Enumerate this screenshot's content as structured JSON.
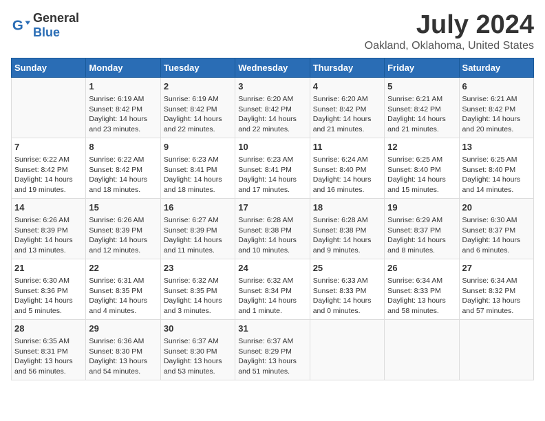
{
  "header": {
    "logo_general": "General",
    "logo_blue": "Blue",
    "title": "July 2024",
    "subtitle": "Oakland, Oklahoma, United States"
  },
  "weekdays": [
    "Sunday",
    "Monday",
    "Tuesday",
    "Wednesday",
    "Thursday",
    "Friday",
    "Saturday"
  ],
  "weeks": [
    [
      {
        "day": "",
        "content": ""
      },
      {
        "day": "1",
        "content": "Sunrise: 6:19 AM\nSunset: 8:42 PM\nDaylight: 14 hours\nand 23 minutes."
      },
      {
        "day": "2",
        "content": "Sunrise: 6:19 AM\nSunset: 8:42 PM\nDaylight: 14 hours\nand 22 minutes."
      },
      {
        "day": "3",
        "content": "Sunrise: 6:20 AM\nSunset: 8:42 PM\nDaylight: 14 hours\nand 22 minutes."
      },
      {
        "day": "4",
        "content": "Sunrise: 6:20 AM\nSunset: 8:42 PM\nDaylight: 14 hours\nand 21 minutes."
      },
      {
        "day": "5",
        "content": "Sunrise: 6:21 AM\nSunset: 8:42 PM\nDaylight: 14 hours\nand 21 minutes."
      },
      {
        "day": "6",
        "content": "Sunrise: 6:21 AM\nSunset: 8:42 PM\nDaylight: 14 hours\nand 20 minutes."
      }
    ],
    [
      {
        "day": "7",
        "content": "Sunrise: 6:22 AM\nSunset: 8:42 PM\nDaylight: 14 hours\nand 19 minutes."
      },
      {
        "day": "8",
        "content": "Sunrise: 6:22 AM\nSunset: 8:42 PM\nDaylight: 14 hours\nand 18 minutes."
      },
      {
        "day": "9",
        "content": "Sunrise: 6:23 AM\nSunset: 8:41 PM\nDaylight: 14 hours\nand 18 minutes."
      },
      {
        "day": "10",
        "content": "Sunrise: 6:23 AM\nSunset: 8:41 PM\nDaylight: 14 hours\nand 17 minutes."
      },
      {
        "day": "11",
        "content": "Sunrise: 6:24 AM\nSunset: 8:40 PM\nDaylight: 14 hours\nand 16 minutes."
      },
      {
        "day": "12",
        "content": "Sunrise: 6:25 AM\nSunset: 8:40 PM\nDaylight: 14 hours\nand 15 minutes."
      },
      {
        "day": "13",
        "content": "Sunrise: 6:25 AM\nSunset: 8:40 PM\nDaylight: 14 hours\nand 14 minutes."
      }
    ],
    [
      {
        "day": "14",
        "content": "Sunrise: 6:26 AM\nSunset: 8:39 PM\nDaylight: 14 hours\nand 13 minutes."
      },
      {
        "day": "15",
        "content": "Sunrise: 6:26 AM\nSunset: 8:39 PM\nDaylight: 14 hours\nand 12 minutes."
      },
      {
        "day": "16",
        "content": "Sunrise: 6:27 AM\nSunset: 8:39 PM\nDaylight: 14 hours\nand 11 minutes."
      },
      {
        "day": "17",
        "content": "Sunrise: 6:28 AM\nSunset: 8:38 PM\nDaylight: 14 hours\nand 10 minutes."
      },
      {
        "day": "18",
        "content": "Sunrise: 6:28 AM\nSunset: 8:38 PM\nDaylight: 14 hours\nand 9 minutes."
      },
      {
        "day": "19",
        "content": "Sunrise: 6:29 AM\nSunset: 8:37 PM\nDaylight: 14 hours\nand 8 minutes."
      },
      {
        "day": "20",
        "content": "Sunrise: 6:30 AM\nSunset: 8:37 PM\nDaylight: 14 hours\nand 6 minutes."
      }
    ],
    [
      {
        "day": "21",
        "content": "Sunrise: 6:30 AM\nSunset: 8:36 PM\nDaylight: 14 hours\nand 5 minutes."
      },
      {
        "day": "22",
        "content": "Sunrise: 6:31 AM\nSunset: 8:35 PM\nDaylight: 14 hours\nand 4 minutes."
      },
      {
        "day": "23",
        "content": "Sunrise: 6:32 AM\nSunset: 8:35 PM\nDaylight: 14 hours\nand 3 minutes."
      },
      {
        "day": "24",
        "content": "Sunrise: 6:32 AM\nSunset: 8:34 PM\nDaylight: 14 hours\nand 1 minute."
      },
      {
        "day": "25",
        "content": "Sunrise: 6:33 AM\nSunset: 8:33 PM\nDaylight: 14 hours\nand 0 minutes."
      },
      {
        "day": "26",
        "content": "Sunrise: 6:34 AM\nSunset: 8:33 PM\nDaylight: 13 hours\nand 58 minutes."
      },
      {
        "day": "27",
        "content": "Sunrise: 6:34 AM\nSunset: 8:32 PM\nDaylight: 13 hours\nand 57 minutes."
      }
    ],
    [
      {
        "day": "28",
        "content": "Sunrise: 6:35 AM\nSunset: 8:31 PM\nDaylight: 13 hours\nand 56 minutes."
      },
      {
        "day": "29",
        "content": "Sunrise: 6:36 AM\nSunset: 8:30 PM\nDaylight: 13 hours\nand 54 minutes."
      },
      {
        "day": "30",
        "content": "Sunrise: 6:37 AM\nSunset: 8:30 PM\nDaylight: 13 hours\nand 53 minutes."
      },
      {
        "day": "31",
        "content": "Sunrise: 6:37 AM\nSunset: 8:29 PM\nDaylight: 13 hours\nand 51 minutes."
      },
      {
        "day": "",
        "content": ""
      },
      {
        "day": "",
        "content": ""
      },
      {
        "day": "",
        "content": ""
      }
    ]
  ]
}
